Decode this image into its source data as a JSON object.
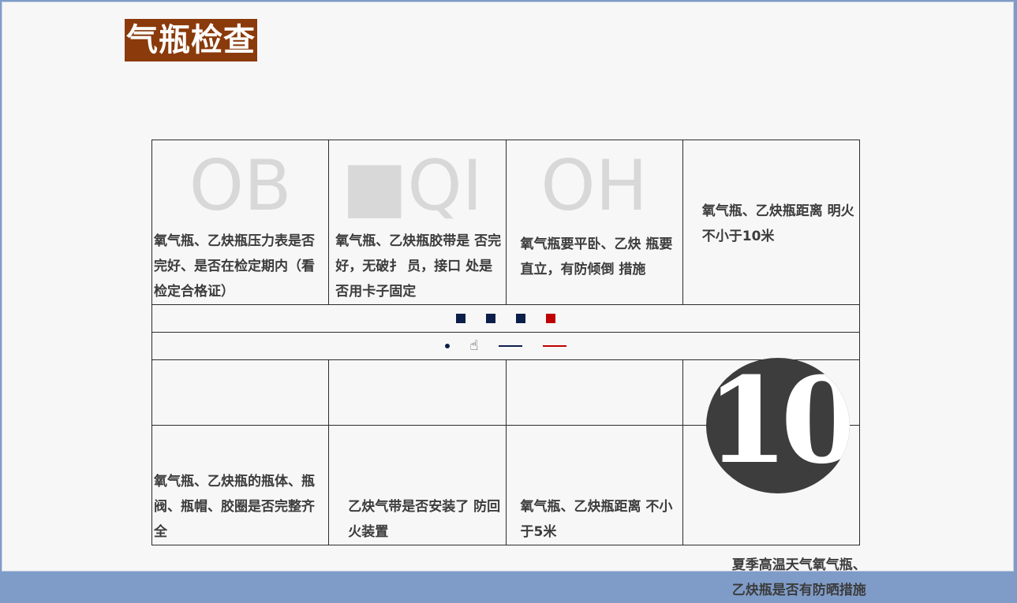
{
  "title": "气瓶检查",
  "watermarks": [
    "OB",
    "■QI",
    "OH"
  ],
  "top_row": [
    "氧气瓶、乙炔瓶压力表是否完好、是否在检定期内（看检定合格证）",
    "氧气瓶、乙炔瓶胶带是 否完好，无破扌 员，接口 处是否用卡子固定",
    "氧气瓶要平卧、乙炔 瓶要直立，有防倾倒 措施",
    "氧气瓶、乙炔瓶距离 明火不小于10米"
  ],
  "bottom_row": [
    "氧气瓶、乙炔瓶的瓶体、瓶阀、瓶帽、胶圈是否完整齐全",
    "乙炔气带是否安装了 防回火装置",
    "氧气瓶、乙炔瓶距离 不小于5米",
    "夏季高温天气氧气瓶、乙炔瓶是否有防晒措施"
  ],
  "badge_number": "10",
  "colors": {
    "title_bg": "#8a3a0b",
    "navy": "#0c1f4a",
    "red": "#c00000",
    "badge_bg": "#3d3d3d"
  },
  "icons": {
    "marker_squares": [
      "navy",
      "navy",
      "navy",
      "red"
    ],
    "row2": [
      "bullet-dot",
      "pointing-hand-icon",
      "navy-dash",
      "red-dash"
    ]
  }
}
